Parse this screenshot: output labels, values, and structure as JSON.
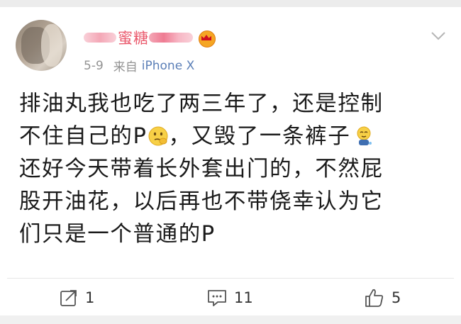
{
  "post": {
    "username_visible": "蜜糖",
    "timestamp": "5-9",
    "source_prefix": "来自",
    "source_device": "iPhone X",
    "body_lines": [
      "排油丸我也吃了两三年了，还是控制",
      "不住自己的P",
      "，又毁了一条裤子",
      "还好今天带着长外套出门的，不然屁",
      "股开油花，以后再也不带侥幸认为它",
      "们只是一个普通的P"
    ],
    "emojis": [
      "thinking-emoji",
      "crying-emoji"
    ]
  },
  "actions": {
    "repost_count": "1",
    "comment_count": "11",
    "like_count": "5"
  },
  "colors": {
    "username": "#ea5a6d",
    "meta_gray": "#939393",
    "device_blue": "#5b7fb7",
    "text": "#1a1a1a"
  }
}
